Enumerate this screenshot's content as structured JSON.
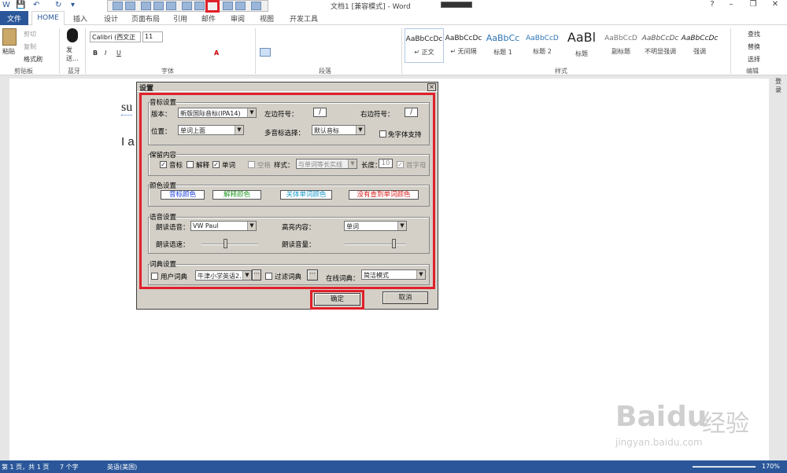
{
  "titlebar": {
    "title": "文档1 [兼容模式] - Word",
    "minimize": "–",
    "restore": "❐",
    "close": "✕",
    "help": "?",
    "save": "💾",
    "undo": "↶",
    "redo": "↻",
    "customize": "▾"
  },
  "tabs": {
    "file": "文件",
    "home": "HOME",
    "insert": "插入",
    "design": "设计",
    "layout": "页面布局",
    "references": "引用",
    "mailings": "邮件",
    "review": "审阅",
    "view": "视图",
    "developer": "开发工具"
  },
  "ribbon": {
    "clipboard": {
      "paste": "粘贴",
      "cut": "剪切",
      "copy": "复制",
      "format_painter": "格式刷",
      "label": "剪贴板"
    },
    "bluetooth": {
      "send": "发送...",
      "label": "蓝牙"
    },
    "font": {
      "name": "Calibri (西文正",
      "size": "11",
      "label": "字体"
    },
    "paragraph": {
      "label": "段落"
    },
    "styles": {
      "items": [
        {
          "preview": "AaBbCcDc",
          "name": "↵ 正文"
        },
        {
          "preview": "AaBbCcDc",
          "name": "↵ 无间隔"
        },
        {
          "preview": "AaBbCc",
          "name": "标题 1"
        },
        {
          "preview": "AaBbCcD",
          "name": "标题 2"
        },
        {
          "preview": "AaBl",
          "name": "标题"
        },
        {
          "preview": "AaBbCcD",
          "name": "副标题"
        },
        {
          "preview": "AaBbCcDc",
          "name": "不明显强调"
        },
        {
          "preview": "AaBbCcDc",
          "name": "强调"
        }
      ],
      "label": "样式"
    },
    "editing": {
      "find": "查找",
      "replace": "替换",
      "select": "选择",
      "label": "编辑",
      "login": "登录"
    }
  },
  "document": {
    "line1": "su",
    "line2": "I a"
  },
  "statusbar": {
    "page": "第 1 页，共 1 页",
    "words": "7 个字",
    "lang": "英语(美国)",
    "zoom": "170%"
  },
  "dialog": {
    "title": "设置",
    "close": "×",
    "phonetic": {
      "title": "音标设置",
      "version_label": "版本：",
      "version": "新版国际音标(IPA14)",
      "left_label": "左边符号：",
      "left": "/",
      "right_label": "右边符号：",
      "right": "/",
      "position_label": "位置：",
      "position": "单词上面",
      "multi_label": "多音标选择：",
      "multi": "默认音标",
      "free": "免字体支持"
    },
    "keep": {
      "title": "保留内容",
      "phonetic": "音标",
      "explain": "解释",
      "word": "单词",
      "space": "空格",
      "style_label": "样式：",
      "style": "与单词等长实线",
      "length_label": "长度：",
      "length": "10",
      "initial": "首字母"
    },
    "color": {
      "title": "颜色设置",
      "phonetic": "音标颜色",
      "explain": "解释颜色",
      "word": "关体单词颜色",
      "notfound": "没有查到单词颜色"
    },
    "voice": {
      "title": "语音设置",
      "voice_label": "朗读语音：",
      "voice": "VW Paul",
      "highlight_label": "高亮内容：",
      "highlight": "单词",
      "speed_label": "朗读语速：",
      "volume_label": "朗读音量："
    },
    "dict": {
      "title": "词典设置",
      "user": "用户词典",
      "user_dict": "牛津小学英语2.",
      "filter": "过滤词典",
      "online_label": "在线词典：",
      "online": "简洁模式",
      "more": "···"
    },
    "ok": "确定",
    "cancel": "取消"
  },
  "watermark": {
    "line1": "Bai",
    "line2": "du",
    "line3": "经验",
    "url": "jingyan.baidu.com"
  }
}
